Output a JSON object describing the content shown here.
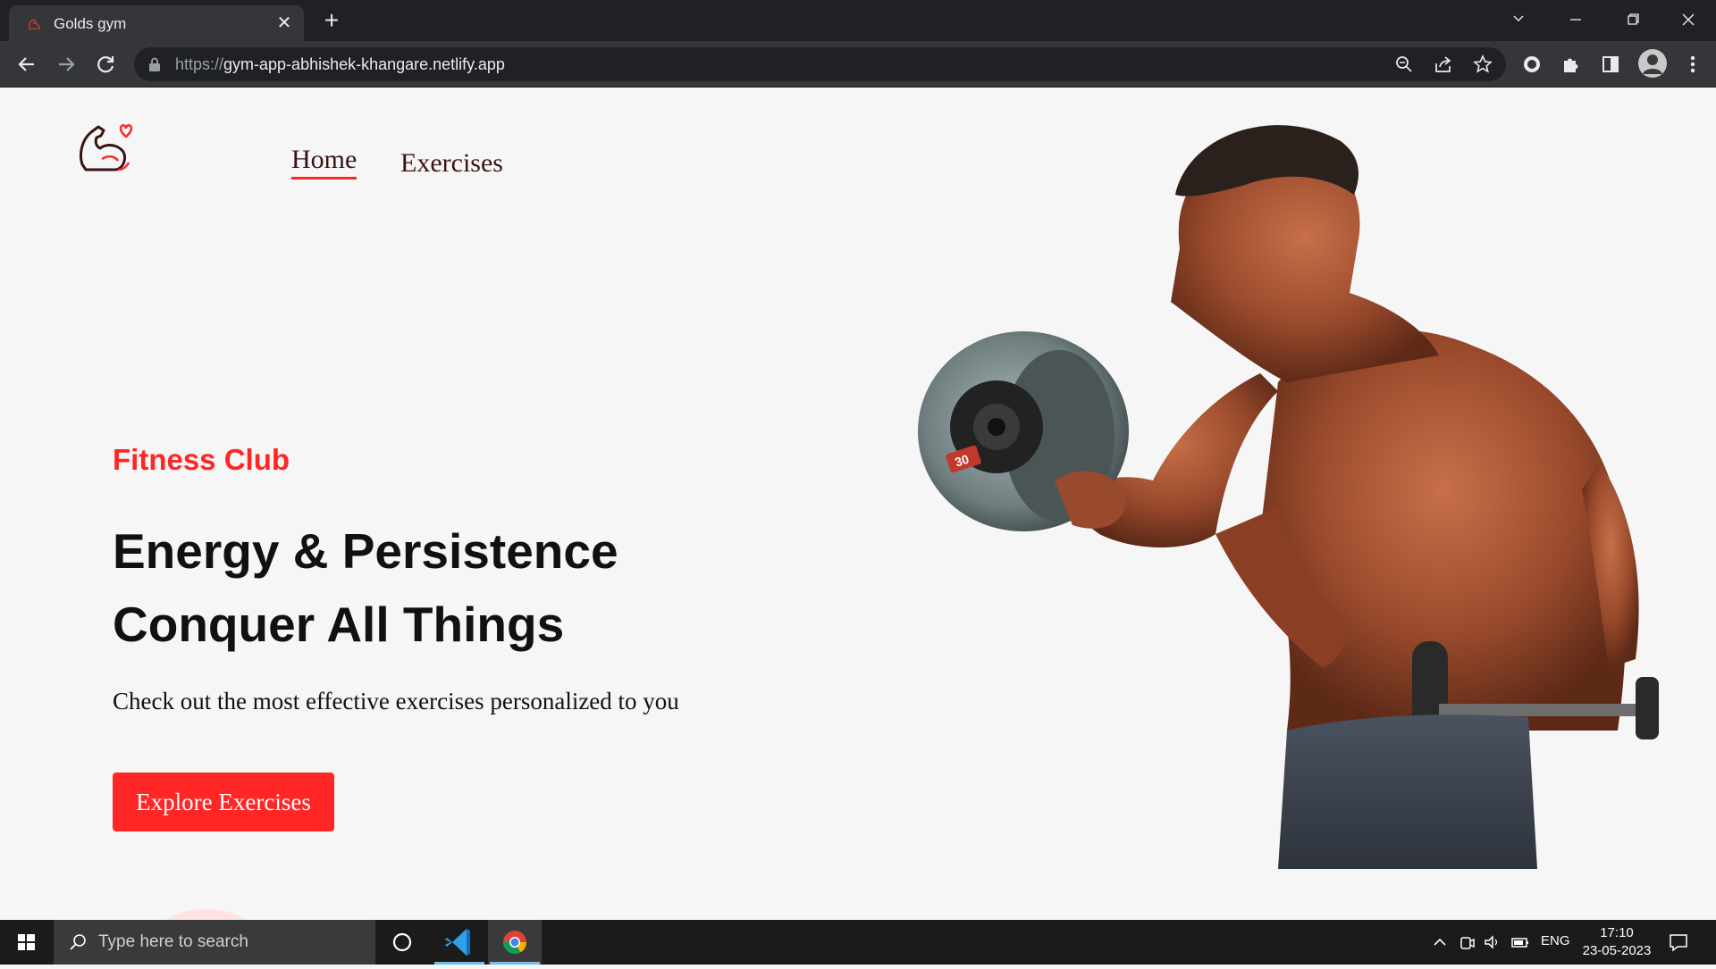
{
  "browser": {
    "tab_title": "Golds gym",
    "url_scheme": "https://",
    "url_host": "gym-app-abhishek-khangare.netlify.app"
  },
  "nav": {
    "home": "Home",
    "exercises": "Exercises"
  },
  "hero": {
    "subtitle": "Fitness Club",
    "title_line1": "Energy & Persistence",
    "title_line2": "Conquer All Things",
    "description": "Check out the most effective exercises personalized to you",
    "button": "Explore Exercises",
    "dumbbell_label": "30"
  },
  "taskbar": {
    "search_placeholder": "Type here to search",
    "language": "ENG",
    "time": "17:10",
    "date": "23-05-2023"
  },
  "colors": {
    "accent": "#ff2625",
    "page_bg": "#f6f6f6",
    "chrome_dark": "#202124"
  }
}
